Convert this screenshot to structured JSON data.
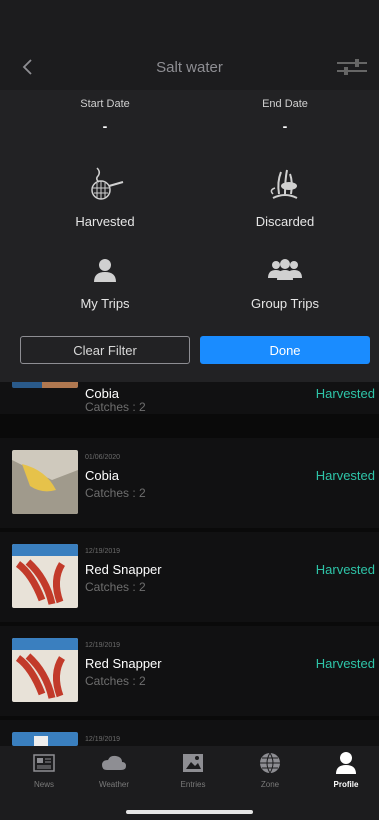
{
  "nav": {
    "title": "Salt water",
    "back_icon": "chevron-left-icon",
    "filter_icon": "sliders-icon"
  },
  "filter": {
    "start_date_label": "Start Date",
    "start_date_value": "-",
    "end_date_label": "End Date",
    "end_date_value": "-",
    "options": [
      {
        "label": "Harvested",
        "icon": "fish-net-icon"
      },
      {
        "label": "Discarded",
        "icon": "release-icon"
      },
      {
        "label": "My Trips",
        "icon": "person-icon"
      },
      {
        "label": "Group Trips",
        "icon": "group-icon"
      }
    ],
    "clear_label": "Clear Filter",
    "done_label": "Done"
  },
  "entries": [
    {
      "date": "",
      "species": "Cobia",
      "catches": "Catches : 2",
      "status": "Harvested"
    },
    {
      "date": "01/06/2020",
      "species": "Cobia",
      "catches": "Catches : 2",
      "status": "Harvested"
    },
    {
      "date": "12/19/2019",
      "species": "Red Snapper",
      "catches": "Catches : 2",
      "status": "Harvested"
    },
    {
      "date": "12/19/2019",
      "species": "Red Snapper",
      "catches": "Catches : 2",
      "status": "Harvested"
    },
    {
      "date": "12/19/2019",
      "species": "",
      "catches": "",
      "status": ""
    }
  ],
  "tabs": [
    {
      "label": "News",
      "icon": "newspaper-icon",
      "active": false
    },
    {
      "label": "Weather",
      "icon": "cloud-icon",
      "active": false
    },
    {
      "label": "Entries",
      "icon": "entries-icon",
      "active": false
    },
    {
      "label": "Zone",
      "icon": "globe-icon",
      "active": false
    },
    {
      "label": "Profile",
      "icon": "profile-icon",
      "active": true
    }
  ],
  "colors": {
    "accent": "#1a8cff",
    "status": "#2ec4a8",
    "panel": "#222224"
  }
}
